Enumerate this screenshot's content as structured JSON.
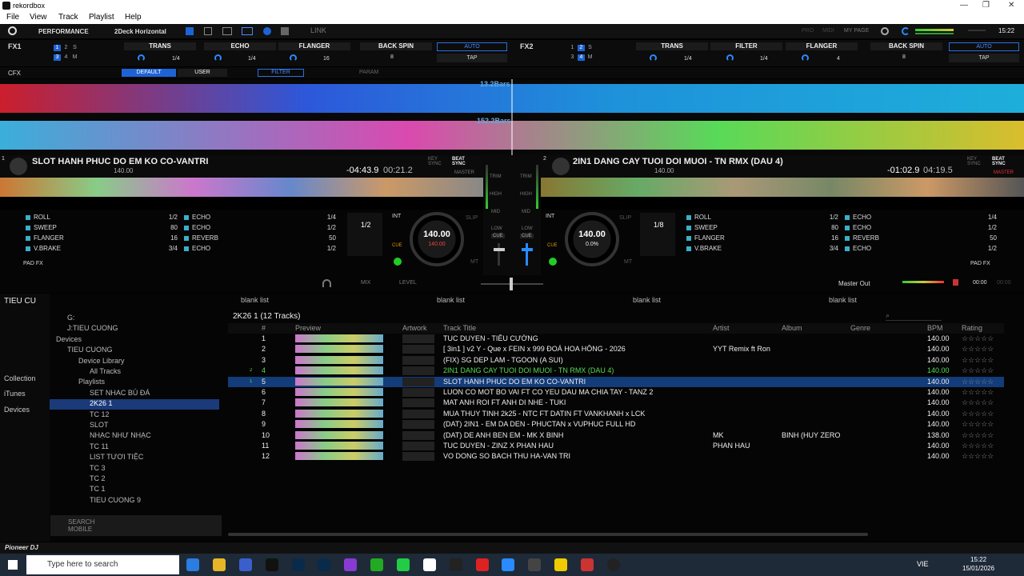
{
  "app": {
    "title": "rekordbox"
  },
  "menu": [
    "File",
    "View",
    "Track",
    "Playlist",
    "Help"
  ],
  "top": {
    "mode": "PERFORMANCE",
    "layout": "2Deck Horizontal",
    "link": "LINK",
    "pro": "PRO",
    "midi": "MIDI",
    "mypage": "MY PAGE",
    "clock": "15:22"
  },
  "fx1": {
    "label": "FX1",
    "slots": [
      "TRANS",
      "ECHO",
      "FLANGER"
    ],
    "beat": [
      "1/4",
      "1/4",
      "16"
    ],
    "backspin": "BACK SPIN",
    "backspin_val": "8",
    "auto": "AUTO",
    "tap": "TAP"
  },
  "fx2": {
    "label": "FX2",
    "slots": [
      "TRANS",
      "FILTER",
      "FLANGER"
    ],
    "beat": [
      "1/4",
      "1/4",
      "4"
    ],
    "backspin": "BACK SPIN",
    "backspin_val": "8",
    "auto": "AUTO",
    "tap": "TAP"
  },
  "cfx": {
    "label": "CFX",
    "default": "DEFAULT",
    "user": "USER",
    "filter": "FILTER",
    "param": "PARAM"
  },
  "wave": {
    "bars1": "13.2Bars",
    "bars2": "152.2Bars"
  },
  "deck1": {
    "num": "1",
    "title": "SLOT HANH PHUC DO EM KO CO-VANTRI",
    "bpm": "140.00",
    "remain": "-04:43.9",
    "elapsed": "00:21.2",
    "loop": "1/2",
    "jog_bpm": "140.00",
    "jog_pct": "140.00",
    "key": "KEY SYNC",
    "beat": "BEAT SYNC",
    "master": "MASTER",
    "mode": "INT",
    "slip": "SLIP",
    "mt": "MT",
    "cue": "CUE",
    "padfx": "PAD FX",
    "pads": [
      {
        "name": "ROLL",
        "val": "1/2",
        "color": "#3ab0c8"
      },
      {
        "name": "SWEEP",
        "val": "80",
        "color": "#3ab0c8"
      },
      {
        "name": "FLANGER",
        "val": "16",
        "color": "#3ab0c8"
      },
      {
        "name": "V.BRAKE",
        "val": "3/4",
        "color": "#3ab0c8"
      },
      {
        "name": "ECHO",
        "val": "1/4",
        "color": "#3ab0c8"
      },
      {
        "name": "ECHO",
        "val": "1/2",
        "color": "#3ab0c8"
      },
      {
        "name": "REVERB",
        "val": "50",
        "color": "#3ab0c8"
      },
      {
        "name": "ECHO",
        "val": "1/2",
        "color": "#3ab0c8"
      }
    ]
  },
  "deck2": {
    "num": "2",
    "title": "2IN1 DANG CAY TUOI DOI MUOI - TN RMX (DAU 4)",
    "bpm": "140.00",
    "remain": "-01:02.9",
    "elapsed": "04:19.5",
    "loop": "1/8",
    "jog_bpm": "140.00",
    "jog_pct": "0.0%",
    "key": "KEY SYNC",
    "beat": "BEAT SYNC",
    "master": "MASTER",
    "mode": "INT",
    "slip": "SLIP",
    "mt": "MT",
    "cue": "CUE",
    "padfx": "PAD FX",
    "pads": [
      {
        "name": "ROLL",
        "val": "1/2",
        "color": "#3ab0c8"
      },
      {
        "name": "SWEEP",
        "val": "80",
        "color": "#3ab0c8"
      },
      {
        "name": "FLANGER",
        "val": "16",
        "color": "#3ab0c8"
      },
      {
        "name": "V.BRAKE",
        "val": "3/4",
        "color": "#3ab0c8"
      },
      {
        "name": "ECHO",
        "val": "1/4",
        "color": "#3ab0c8"
      },
      {
        "name": "ECHO",
        "val": "1/2",
        "color": "#3ab0c8"
      },
      {
        "name": "REVERB",
        "val": "50",
        "color": "#3ab0c8"
      },
      {
        "name": "ECHO",
        "val": "1/2",
        "color": "#3ab0c8"
      }
    ]
  },
  "mixer": {
    "trim": "TRIM",
    "high": "HIGH",
    "mid": "MID",
    "low": "LOW",
    "cue": "CUE",
    "mix": "MIX",
    "level": "LEVEL",
    "master_out": "Master Out",
    "time_a": "00:00",
    "time_b": "00:00"
  },
  "browser": {
    "left_tab": "TIEU CU",
    "collection": "Collection",
    "itunes": "iTunes",
    "devices": "Devices",
    "blank": "blank list",
    "playlist_title": "2K26 1 (12 Tracks)",
    "search_mobile": "SEARCH MOBILE",
    "tree": [
      {
        "t": "G:",
        "lvl": 1
      },
      {
        "t": "J:TIEU CUONG",
        "lvl": 1
      },
      {
        "t": "Devices",
        "lvl": 0
      },
      {
        "t": "TIEU CUONG",
        "lvl": 1
      },
      {
        "t": "Device Library",
        "lvl": 2
      },
      {
        "t": "All Tracks",
        "lvl": 3
      },
      {
        "t": "Playlists",
        "lvl": 2
      },
      {
        "t": "SET NHAC BÚ ĐÁ",
        "lvl": 3
      },
      {
        "t": "2K26 1",
        "lvl": 3,
        "sel": true
      },
      {
        "t": "TC 12",
        "lvl": 3
      },
      {
        "t": "SLOT",
        "lvl": 3
      },
      {
        "t": "NHẠC NHƯ NHẠC",
        "lvl": 3
      },
      {
        "t": "TC 11",
        "lvl": 3
      },
      {
        "t": "LIST TƯƠI TIỆC",
        "lvl": 3
      },
      {
        "t": "TC 3",
        "lvl": 3
      },
      {
        "t": "TC 2",
        "lvl": 3
      },
      {
        "t": "TC 1",
        "lvl": 3
      },
      {
        "t": "TIEU CUONG 9",
        "lvl": 3
      }
    ],
    "cols": [
      "#",
      "Preview",
      "Artwork",
      "Track Title",
      "Artist",
      "Album",
      "Genre",
      "BPM",
      "Rating"
    ],
    "rows": [
      {
        "n": "1",
        "title": "TUC DUYEN - TIÊU CƯỜNG",
        "artist": "",
        "album": "",
        "bpm": "140.00"
      },
      {
        "n": "2",
        "title": "[ 3in1 ] v2 Y - Que x FEIN x 999 ĐOÁ HOA HỒNG - 2026",
        "artist": "YYT Remix ft Ron",
        "album": "",
        "bpm": "140.00"
      },
      {
        "n": "3",
        "title": "(FIX) SG DEP LAM - TGOON (A SUI)",
        "artist": "",
        "album": "",
        "bpm": "140.00"
      },
      {
        "n": "4",
        "title": "2IN1 DANG CAY TUOI DOI MUOI - TN RMX (DAU 4)",
        "artist": "",
        "album": "",
        "bpm": "140.00",
        "deck": "2"
      },
      {
        "n": "5",
        "title": "SLOT HANH PHUC DO EM KO CO-VANTRI",
        "artist": "",
        "album": "",
        "bpm": "140.00",
        "deck": "1",
        "sel": true
      },
      {
        "n": "6",
        "title": "LUON CO MOT BO VAI FT CO YEU DAU MA CHIA TAY - TANZ 2",
        "artist": "",
        "album": "",
        "bpm": "140.00"
      },
      {
        "n": "7",
        "title": "MAT ANH ROI FT ANH DI NHE - TUKI",
        "artist": "",
        "album": "",
        "bpm": "140.00"
      },
      {
        "n": "8",
        "title": "MUA THUY TINH 2k25 - NTC FT DATIN FT VANKHANH x LCK",
        "artist": "",
        "album": "",
        "bpm": "140.00"
      },
      {
        "n": "9",
        "title": "(DAT) 2IN1 - EM DA DEN - PHUCTAN x VUPHUC FULL HD",
        "artist": "",
        "album": "",
        "bpm": "140.00"
      },
      {
        "n": "10",
        "title": "(DAT) DE ANH BEN EM - MK X BINH",
        "artist": "MK",
        "album": "BINH (HUY ZERO",
        "bpm": "138.00"
      },
      {
        "n": "11",
        "title": "TUC DUYEN - ZINZ X PHAN HAU",
        "artist": "PHAN HAU",
        "album": "",
        "bpm": "140.00"
      },
      {
        "n": "12",
        "title": "VO DONG SO BACH THU HA-VAN TRI",
        "artist": "",
        "album": "",
        "bpm": "140.00"
      }
    ]
  },
  "brand": "Pioneer DJ",
  "taskbar": {
    "search": "Type here to search",
    "time": "15:22",
    "date": "15/01/2026",
    "lang": "VIE"
  }
}
